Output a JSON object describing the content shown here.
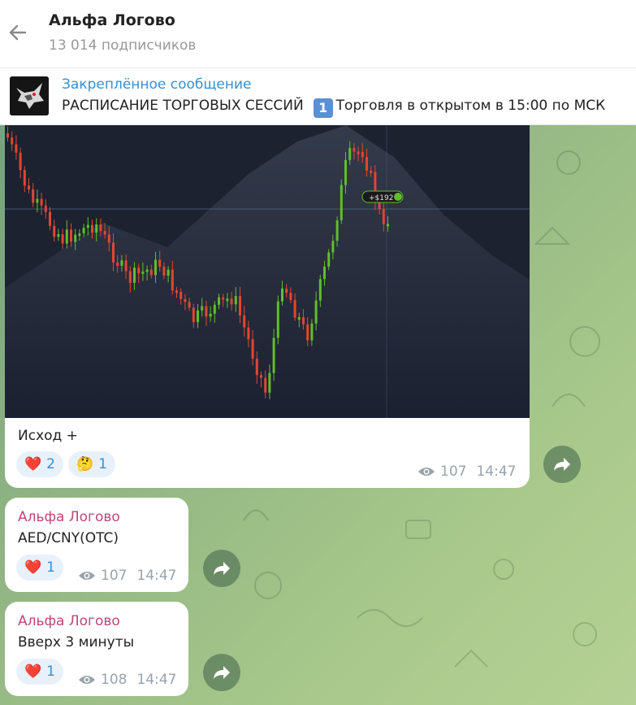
{
  "header": {
    "title": "Альфа Логово",
    "subtitle": "13 014 подписчиков"
  },
  "pinned": {
    "title": "Закреплённое сообщение",
    "text_part1": "РАСПИСАНИЕ ТОРГОВЫХ СЕССИЙ",
    "keycap": "1",
    "text_part2": "Торговля в открытом в 15:00 по МСК"
  },
  "messages": [
    {
      "chart_badge": "+$192",
      "caption": "Исход +",
      "reactions": [
        {
          "emoji": "❤️",
          "count": "2"
        },
        {
          "emoji": "🤔",
          "count": "1"
        }
      ],
      "views": "107",
      "time": "14:47"
    },
    {
      "sender": "Альфа Логово",
      "text": "AED/CNY(OTC)",
      "reactions": [
        {
          "emoji": "❤️",
          "count": "1"
        }
      ],
      "views": "107",
      "time": "14:47"
    },
    {
      "sender": "Альфа Логово",
      "text": "Вверх 3 минуты",
      "reactions": [
        {
          "emoji": "❤️",
          "count": "1"
        }
      ],
      "views": "108",
      "time": "14:47"
    }
  ],
  "colors": {
    "accent": "#3390d6",
    "sender": "#c0457a",
    "candle_up": "#5fbf2a",
    "candle_down": "#e2462f"
  }
}
